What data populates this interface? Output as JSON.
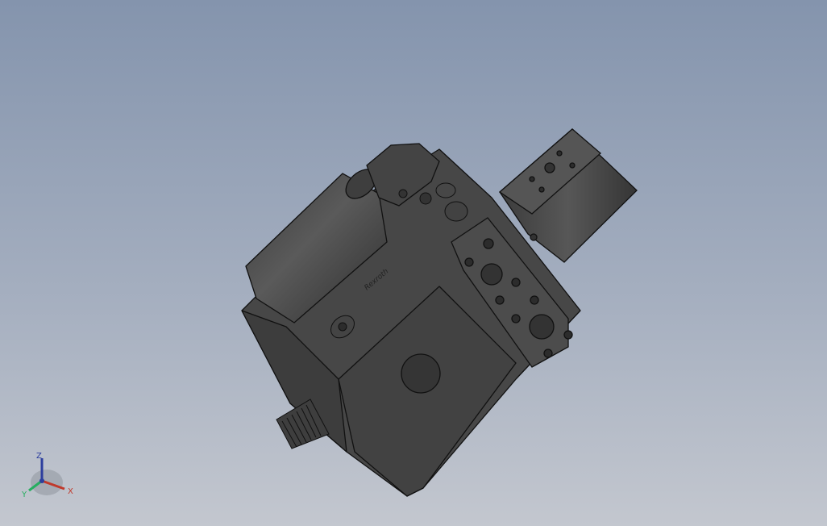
{
  "viewport": {
    "background_top": "#8494ad",
    "background_bottom": "#c3c7cf"
  },
  "model": {
    "description_icon": "hydraulic-pump-3d-model",
    "body_color": "#4a4a4a",
    "edge_color": "#111111",
    "logo_text": "Rexroth"
  },
  "triad": {
    "x_label": "X",
    "y_label": "Y",
    "z_label": "Z",
    "x_color": "#c0392b",
    "y_color": "#27ae60",
    "z_color": "#2c3e9e"
  }
}
